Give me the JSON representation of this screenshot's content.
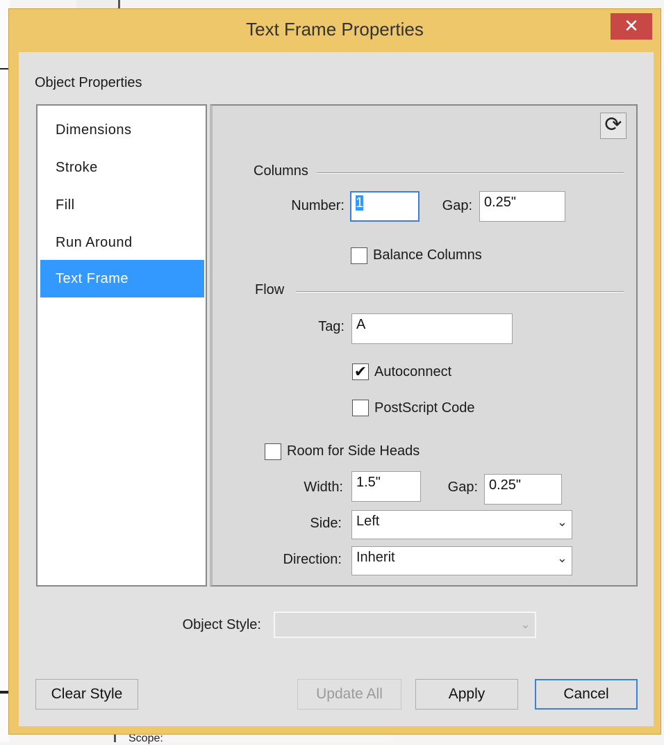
{
  "window": {
    "title": "Text Frame Properties",
    "close_glyph": "✕"
  },
  "group_label": "Object Properties",
  "nav": {
    "items": [
      {
        "label": "Dimensions"
      },
      {
        "label": "Stroke"
      },
      {
        "label": "Fill"
      },
      {
        "label": "Run Around"
      },
      {
        "label": "Text Frame"
      }
    ],
    "selected": "Text Frame"
  },
  "refresh_icon": {
    "name": "refresh-icon",
    "glyph": "⟳"
  },
  "columns": {
    "section_label": "Columns",
    "number_label": "Number:",
    "number_value": "1",
    "gap_label": "Gap:",
    "gap_value": "0.25\"",
    "balance_label": "Balance Columns",
    "balance_checked": false
  },
  "flow": {
    "section_label": "Flow",
    "tag_label": "Tag:",
    "tag_value": "A",
    "autoconnect_label": "Autoconnect",
    "autoconnect_checked": true,
    "postscript_label": "PostScript Code",
    "postscript_checked": false
  },
  "side_heads": {
    "room_label": "Room for Side Heads",
    "room_checked": false,
    "width_label": "Width:",
    "width_value": "1.5\"",
    "gap_label": "Gap:",
    "gap_value": "0.25\"",
    "side_label": "Side:",
    "side_value": "Left",
    "direction_label": "Direction:",
    "direction_value": "Inherit"
  },
  "object_style": {
    "label": "Object Style:",
    "value": ""
  },
  "buttons": {
    "clear_style": "Clear Style",
    "update_all": "Update All",
    "apply": "Apply",
    "cancel": "Cancel"
  },
  "checkmark_glyph": "✔",
  "chevron_glyph": "⌄",
  "background": {
    "scope_fragment": "Scope:"
  },
  "colors": {
    "title_bar": "#eec76b",
    "close_button": "#c74845",
    "selection": "#3399ff",
    "focus_border": "#3d7fd6"
  }
}
